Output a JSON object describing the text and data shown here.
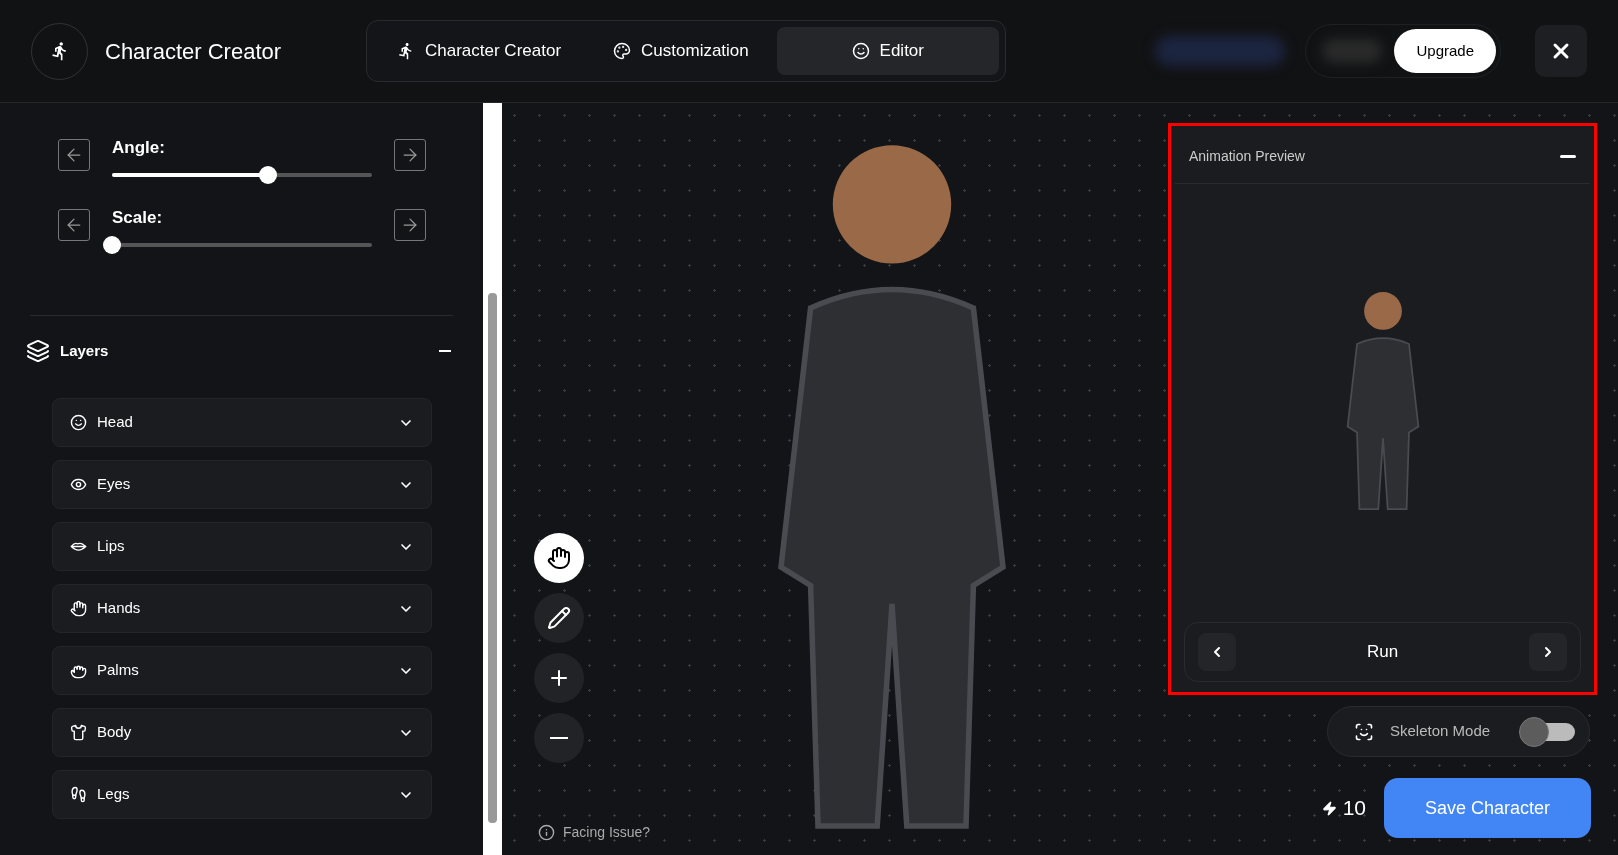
{
  "header": {
    "app_title": "Character Creator",
    "tabs": [
      {
        "label": "Character Creator",
        "selected": false
      },
      {
        "label": "Customization",
        "selected": false
      },
      {
        "label": "Editor",
        "selected": true
      }
    ],
    "upgrade_button": "Upgrade"
  },
  "sidebar": {
    "sliders": [
      {
        "label": "Angle:",
        "level": 0.6
      },
      {
        "label": "Scale:",
        "level": 0
      }
    ],
    "layers": {
      "title": "Layers",
      "expanded": true,
      "items": [
        {
          "label": "Head"
        },
        {
          "label": "Eyes"
        },
        {
          "label": "Lips"
        },
        {
          "label": "Hands"
        },
        {
          "label": "Palms"
        },
        {
          "label": "Body"
        },
        {
          "label": "Legs"
        }
      ]
    }
  },
  "canvas": {
    "tools": [
      {
        "kind": "hand",
        "selected": true
      },
      {
        "kind": "pencil",
        "selected": false
      },
      {
        "kind": "zoom-in",
        "selected": false
      },
      {
        "kind": "zoom-out",
        "selected": false
      }
    ],
    "facing_issue": "Facing Issue?",
    "animation_preview": {
      "title": "Animation Preview",
      "highlighted": true,
      "animation": "Run"
    },
    "skeleton_mode": {
      "label": "Skeleton Mode",
      "on": false
    },
    "credits": "10",
    "save_button": "Save Character"
  }
}
